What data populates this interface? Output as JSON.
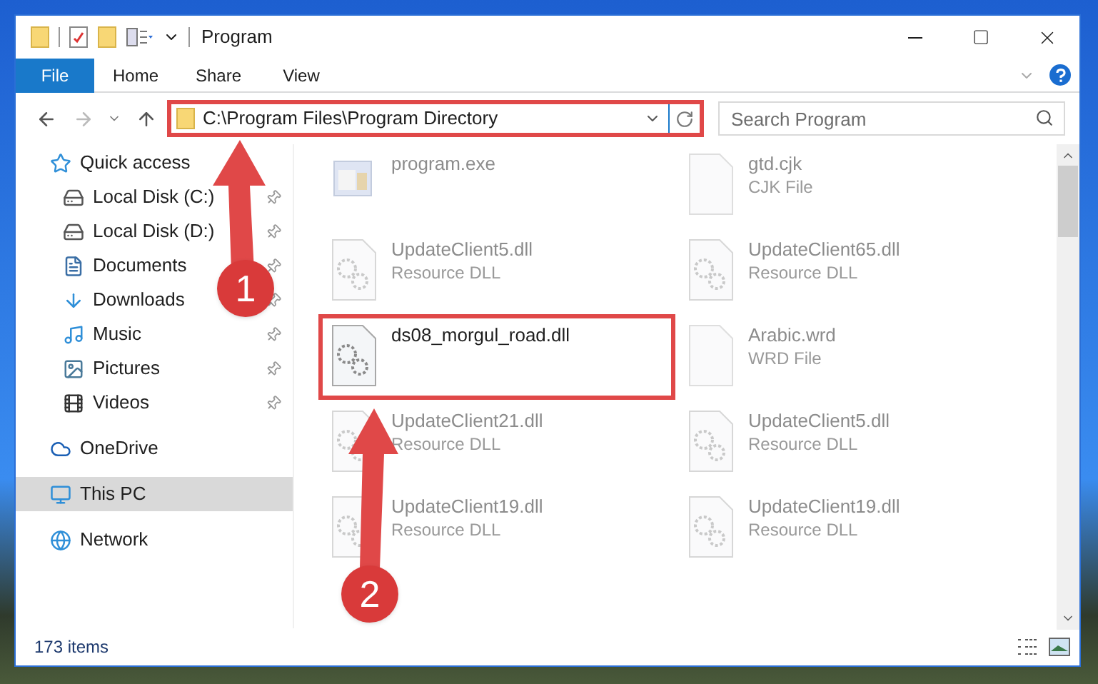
{
  "window": {
    "title": "Program"
  },
  "ribbon": {
    "tabs": [
      {
        "label": "File",
        "kind": "menu"
      },
      {
        "label": "Home",
        "kind": "tab"
      },
      {
        "label": "Share",
        "kind": "tab"
      },
      {
        "label": "View",
        "kind": "tab"
      }
    ]
  },
  "address_bar": {
    "path": "C:\\Program Files\\Program Directory",
    "highlighted": true
  },
  "search": {
    "placeholder": "Search Program"
  },
  "nav": [
    {
      "label": "Quick access",
      "selected": false,
      "children": [
        {
          "label": "Local Disk (C:)",
          "pinned": true
        },
        {
          "label": "Local Disk (D:)",
          "pinned": true
        },
        {
          "label": "Documents",
          "pinned": true
        },
        {
          "label": "Downloads",
          "pinned": true
        },
        {
          "label": "Music",
          "pinned": true
        },
        {
          "label": "Pictures",
          "pinned": true
        },
        {
          "label": "Videos",
          "pinned": true
        }
      ]
    },
    {
      "label": "OneDrive",
      "selected": false
    },
    {
      "label": "This PC",
      "selected": true
    },
    {
      "label": "Network",
      "selected": false
    }
  ],
  "files": [
    {
      "name": "program.exe",
      "kind": "exe",
      "faded": true,
      "highlighted": false
    },
    {
      "name": "gtd.cjk",
      "type": "CJK File",
      "kind": "blank",
      "faded": true,
      "highlighted": false
    },
    {
      "name": "UpdateClient5.dll",
      "type": "Resource DLL",
      "kind": "dll",
      "faded": true,
      "highlighted": false
    },
    {
      "name": "UpdateClient65.dll",
      "type": "Resource DLL",
      "kind": "dll",
      "faded": true,
      "highlighted": false
    },
    {
      "name": "ds08_morgul_road.dll",
      "kind": "dll",
      "faded": false,
      "highlighted": true
    },
    {
      "name": "Arabic.wrd",
      "type": "WRD File",
      "kind": "blank",
      "faded": true,
      "highlighted": false
    },
    {
      "name": "UpdateClient21.dll",
      "type": "Resource DLL",
      "kind": "dll",
      "faded": true,
      "highlighted": false
    },
    {
      "name": "UpdateClient5.dll",
      "type": "Resource DLL",
      "kind": "dll",
      "faded": true,
      "highlighted": false
    },
    {
      "name": "UpdateClient19.dll",
      "type": "Resource DLL",
      "kind": "dll",
      "faded": true,
      "highlighted": false
    },
    {
      "name": "UpdateClient19.dll",
      "type": "Resource DLL",
      "kind": "dll",
      "faded": true,
      "highlighted": false
    }
  ],
  "status_bar": {
    "item_count": "173 items"
  },
  "annotations": [
    {
      "number": "1"
    },
    {
      "number": "2"
    }
  ]
}
